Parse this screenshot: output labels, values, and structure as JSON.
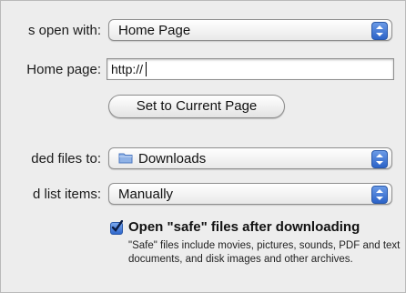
{
  "rows": {
    "open_with": {
      "label": "s open with:",
      "value": "Home Page"
    },
    "home_page": {
      "label": "Home page:",
      "value": "http://"
    },
    "set_current_button": "Set to Current Page",
    "save_files": {
      "label": "ded files to:",
      "value": "Downloads"
    },
    "list_items": {
      "label": "d list items:",
      "value": "Manually"
    }
  },
  "safe_files": {
    "checked": true,
    "label": "Open \"safe\" files after downloading",
    "help": "\"Safe\" files include movies, pictures, sounds, PDF and text documents, and disk images and other archives."
  },
  "colors": {
    "accent": "#3a6fd0",
    "background": "#ededed"
  }
}
